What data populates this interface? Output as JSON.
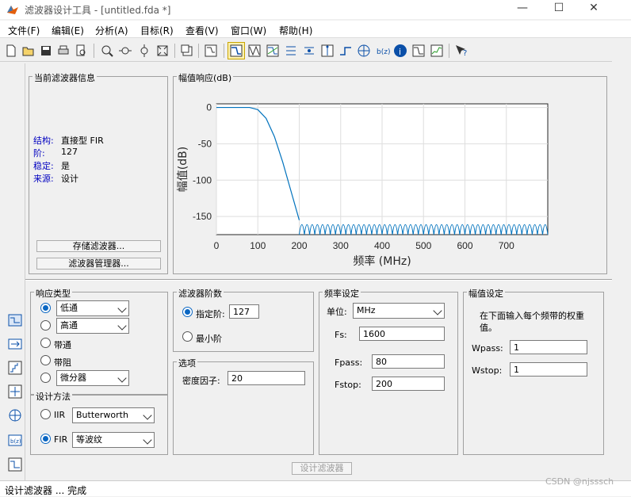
{
  "window": {
    "title": "滤波器设计工具 -  [untitled.fda *]",
    "minimize": "—",
    "maximize": "☐",
    "close": "✕"
  },
  "menu": [
    "文件(F)",
    "编辑(E)",
    "分析(A)",
    "目标(R)",
    "查看(V)",
    "窗口(W)",
    "帮助(H)"
  ],
  "filter_info": {
    "title": "当前滤波器信息",
    "rows": [
      {
        "key": "结构:",
        "value": "直接型 FIR"
      },
      {
        "key": "阶:",
        "value": "127"
      },
      {
        "key": "稳定:",
        "value": "是"
      },
      {
        "key": "来源:",
        "value": "设计"
      }
    ],
    "store_button": "存储滤波器...",
    "manager_button": "滤波器管理器..."
  },
  "magnitude_panel": {
    "title": "幅值响应(dB)"
  },
  "chart_data": {
    "type": "line",
    "title": "",
    "xlabel": "频率 (MHz)",
    "ylabel": "幅值(dB)",
    "xlim": [
      0,
      800
    ],
    "ylim": [
      -175,
      5
    ],
    "xticks": [
      0,
      100,
      200,
      300,
      400,
      500,
      600,
      700
    ],
    "yticks": [
      0,
      -50,
      -100,
      -150
    ],
    "grid": true,
    "color": "#0072bd",
    "passband": {
      "x": [
        0,
        80
      ],
      "value": 0
    },
    "transition": {
      "x": [
        80,
        100,
        120,
        140,
        160,
        180,
        200
      ],
      "y": [
        0,
        -3,
        -15,
        -40,
        -75,
        -115,
        -155
      ]
    },
    "stopband": {
      "x": [
        200,
        800
      ],
      "lobe_period": 12.5,
      "ripple_top": -154,
      "ripple_bottom": -175
    }
  },
  "response_type": {
    "title": "响应类型",
    "options": [
      {
        "label": "低通",
        "selected": true,
        "combo": true
      },
      {
        "label": "高通",
        "selected": false,
        "combo": true
      },
      {
        "label": "带通",
        "selected": false,
        "combo": false
      },
      {
        "label": "带阻",
        "selected": false,
        "combo": false
      },
      {
        "label": "微分器",
        "selected": false,
        "combo": true
      }
    ]
  },
  "design_method": {
    "title": "设计方法",
    "iir": {
      "label": "IIR",
      "value": "Butterworth",
      "selected": false
    },
    "fir": {
      "label": "FIR",
      "value": "等波纹",
      "selected": true
    }
  },
  "filter_order": {
    "title": "滤波器阶数",
    "specify_label": "指定阶:",
    "specify_value": "127",
    "minimum_label": "最小阶",
    "specify_selected": true
  },
  "options": {
    "title": "选项",
    "density_label": "密度因子:",
    "density_value": "20"
  },
  "freq_spec": {
    "title": "频率设定",
    "unit_label": "单位:",
    "unit_value": "MHz",
    "fs_label": "Fs:",
    "fs_value": "1600",
    "fpass_label": "Fpass:",
    "fpass_value": "80",
    "fstop_label": "Fstop:",
    "fstop_value": "200"
  },
  "mag_spec": {
    "title": "幅值设定",
    "note": "在下面输入每个频带的权重值。",
    "wpass_label": "Wpass:",
    "wpass_value": "1",
    "wstop_label": "Wstop:",
    "wstop_value": "1"
  },
  "design_button": "设计滤波器",
  "status": "设计滤波器 ... 完成",
  "watermark": "CSDN @njsssch"
}
